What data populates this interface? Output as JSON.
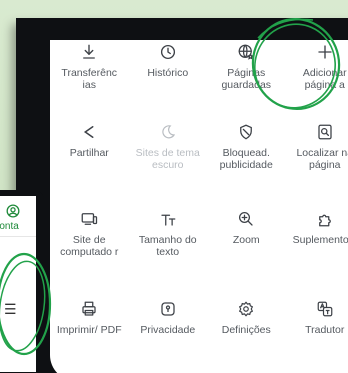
{
  "menu": {
    "items": [
      {
        "label": "Transferênc ias",
        "icon": "download-icon",
        "disabled": false
      },
      {
        "label": "Histórico",
        "icon": "clock-icon",
        "disabled": false
      },
      {
        "label": "Páginas guardadas",
        "icon": "globe-star-icon",
        "disabled": false
      },
      {
        "label": "Adicionar página a",
        "icon": "plus-icon",
        "disabled": false
      },
      {
        "label": "Partilhar",
        "icon": "share-icon",
        "disabled": false
      },
      {
        "label": "Sites de tema escuro",
        "icon": "moon-icon",
        "disabled": true
      },
      {
        "label": "Bloquead. publicidade",
        "icon": "block-icon",
        "disabled": false
      },
      {
        "label": "Localizar na página",
        "icon": "find-in-page-icon",
        "disabled": false
      },
      {
        "label": "Site de computado r",
        "icon": "desktop-icon",
        "disabled": false
      },
      {
        "label": "Tamanho do texto",
        "icon": "text-size-icon",
        "disabled": false
      },
      {
        "label": "Zoom",
        "icon": "zoom-icon",
        "disabled": false
      },
      {
        "label": "Suplemento s",
        "icon": "puzzle-icon",
        "disabled": false
      },
      {
        "label": "Imprimir/ PDF",
        "icon": "print-icon",
        "disabled": false
      },
      {
        "label": "Privacidade",
        "icon": "shield-icon",
        "disabled": false
      },
      {
        "label": "Definições",
        "icon": "gear-icon",
        "disabled": false
      },
      {
        "label": "Tradutor",
        "icon": "translate-icon",
        "disabled": false
      }
    ]
  },
  "side_panel": {
    "account_label": "a conta",
    "account_icon": "account-icon",
    "menu_icon": "hamburger-icon"
  },
  "colors": {
    "accent": "#1f8a3a",
    "ring": "#22a24a",
    "icon": "#3d4147",
    "label": "#555a60",
    "disabled": "#b9bdc2",
    "background": "#d3e6c8"
  }
}
